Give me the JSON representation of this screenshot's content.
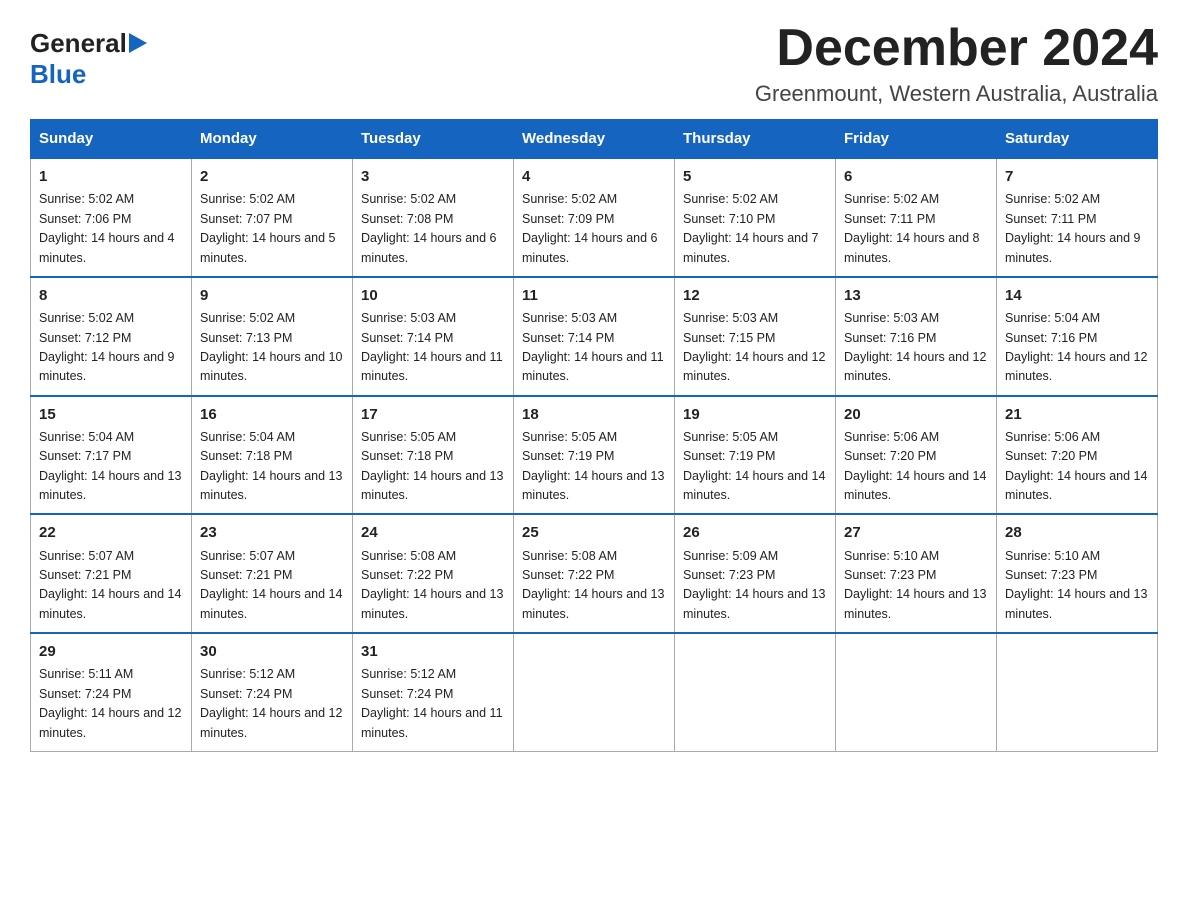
{
  "header": {
    "logo_general": "General",
    "logo_blue": "Blue",
    "month_title": "December 2024",
    "subtitle": "Greenmount, Western Australia, Australia"
  },
  "days_of_week": [
    "Sunday",
    "Monday",
    "Tuesday",
    "Wednesday",
    "Thursday",
    "Friday",
    "Saturday"
  ],
  "weeks": [
    [
      {
        "day": "1",
        "sunrise": "5:02 AM",
        "sunset": "7:06 PM",
        "daylight": "14 hours and 4 minutes."
      },
      {
        "day": "2",
        "sunrise": "5:02 AM",
        "sunset": "7:07 PM",
        "daylight": "14 hours and 5 minutes."
      },
      {
        "day": "3",
        "sunrise": "5:02 AM",
        "sunset": "7:08 PM",
        "daylight": "14 hours and 6 minutes."
      },
      {
        "day": "4",
        "sunrise": "5:02 AM",
        "sunset": "7:09 PM",
        "daylight": "14 hours and 6 minutes."
      },
      {
        "day": "5",
        "sunrise": "5:02 AM",
        "sunset": "7:10 PM",
        "daylight": "14 hours and 7 minutes."
      },
      {
        "day": "6",
        "sunrise": "5:02 AM",
        "sunset": "7:11 PM",
        "daylight": "14 hours and 8 minutes."
      },
      {
        "day": "7",
        "sunrise": "5:02 AM",
        "sunset": "7:11 PM",
        "daylight": "14 hours and 9 minutes."
      }
    ],
    [
      {
        "day": "8",
        "sunrise": "5:02 AM",
        "sunset": "7:12 PM",
        "daylight": "14 hours and 9 minutes."
      },
      {
        "day": "9",
        "sunrise": "5:02 AM",
        "sunset": "7:13 PM",
        "daylight": "14 hours and 10 minutes."
      },
      {
        "day": "10",
        "sunrise": "5:03 AM",
        "sunset": "7:14 PM",
        "daylight": "14 hours and 11 minutes."
      },
      {
        "day": "11",
        "sunrise": "5:03 AM",
        "sunset": "7:14 PM",
        "daylight": "14 hours and 11 minutes."
      },
      {
        "day": "12",
        "sunrise": "5:03 AM",
        "sunset": "7:15 PM",
        "daylight": "14 hours and 12 minutes."
      },
      {
        "day": "13",
        "sunrise": "5:03 AM",
        "sunset": "7:16 PM",
        "daylight": "14 hours and 12 minutes."
      },
      {
        "day": "14",
        "sunrise": "5:04 AM",
        "sunset": "7:16 PM",
        "daylight": "14 hours and 12 minutes."
      }
    ],
    [
      {
        "day": "15",
        "sunrise": "5:04 AM",
        "sunset": "7:17 PM",
        "daylight": "14 hours and 13 minutes."
      },
      {
        "day": "16",
        "sunrise": "5:04 AM",
        "sunset": "7:18 PM",
        "daylight": "14 hours and 13 minutes."
      },
      {
        "day": "17",
        "sunrise": "5:05 AM",
        "sunset": "7:18 PM",
        "daylight": "14 hours and 13 minutes."
      },
      {
        "day": "18",
        "sunrise": "5:05 AM",
        "sunset": "7:19 PM",
        "daylight": "14 hours and 13 minutes."
      },
      {
        "day": "19",
        "sunrise": "5:05 AM",
        "sunset": "7:19 PM",
        "daylight": "14 hours and 14 minutes."
      },
      {
        "day": "20",
        "sunrise": "5:06 AM",
        "sunset": "7:20 PM",
        "daylight": "14 hours and 14 minutes."
      },
      {
        "day": "21",
        "sunrise": "5:06 AM",
        "sunset": "7:20 PM",
        "daylight": "14 hours and 14 minutes."
      }
    ],
    [
      {
        "day": "22",
        "sunrise": "5:07 AM",
        "sunset": "7:21 PM",
        "daylight": "14 hours and 14 minutes."
      },
      {
        "day": "23",
        "sunrise": "5:07 AM",
        "sunset": "7:21 PM",
        "daylight": "14 hours and 14 minutes."
      },
      {
        "day": "24",
        "sunrise": "5:08 AM",
        "sunset": "7:22 PM",
        "daylight": "14 hours and 13 minutes."
      },
      {
        "day": "25",
        "sunrise": "5:08 AM",
        "sunset": "7:22 PM",
        "daylight": "14 hours and 13 minutes."
      },
      {
        "day": "26",
        "sunrise": "5:09 AM",
        "sunset": "7:23 PM",
        "daylight": "14 hours and 13 minutes."
      },
      {
        "day": "27",
        "sunrise": "5:10 AM",
        "sunset": "7:23 PM",
        "daylight": "14 hours and 13 minutes."
      },
      {
        "day": "28",
        "sunrise": "5:10 AM",
        "sunset": "7:23 PM",
        "daylight": "14 hours and 13 minutes."
      }
    ],
    [
      {
        "day": "29",
        "sunrise": "5:11 AM",
        "sunset": "7:24 PM",
        "daylight": "14 hours and 12 minutes."
      },
      {
        "day": "30",
        "sunrise": "5:12 AM",
        "sunset": "7:24 PM",
        "daylight": "14 hours and 12 minutes."
      },
      {
        "day": "31",
        "sunrise": "5:12 AM",
        "sunset": "7:24 PM",
        "daylight": "14 hours and 11 minutes."
      },
      null,
      null,
      null,
      null
    ]
  ]
}
